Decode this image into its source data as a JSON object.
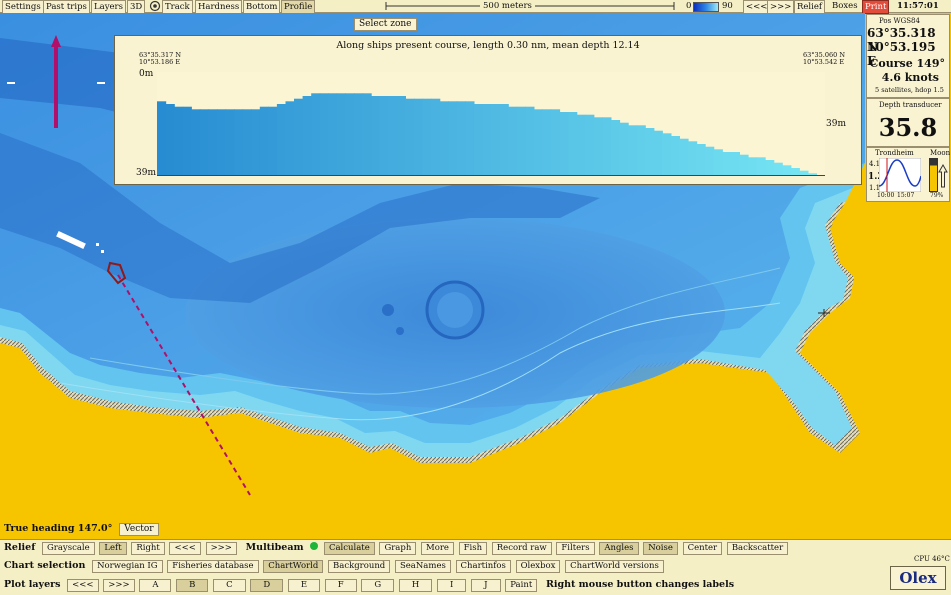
{
  "toolbar": {
    "items": [
      "Settings",
      "Past trips",
      "Layers",
      "3D",
      "Track",
      "Hardness",
      "Bottom",
      "Profile"
    ],
    "scale_label": "500 meters",
    "depth_min": "0",
    "depth_max": "90",
    "nav_left": "<<<",
    "nav_right": ">>>",
    "relief": "Relief",
    "boxes": "Boxes",
    "print": "Print",
    "clock": "11:57:01"
  },
  "select_zone": "Select zone",
  "profile": {
    "title": "Along ships present course, length 0.30 nm, mean depth 12.14",
    "start_coord": "63°35.317 N\n10°53.186 E",
    "end_coord": "63°35.060 N\n10°53.542 E",
    "top_depth": "0m",
    "bottom_depth": "39m",
    "right_depth": "39m",
    "depth_profile": [
      28,
      27,
      26,
      26,
      25,
      25,
      25,
      25,
      25,
      25,
      25,
      25,
      26,
      26,
      27,
      28,
      29,
      30,
      31,
      31,
      31,
      31,
      31,
      31,
      31,
      30,
      30,
      30,
      30,
      29,
      29,
      29,
      29,
      28,
      28,
      28,
      28,
      27,
      27,
      27,
      27,
      26,
      26,
      26,
      25,
      25,
      25,
      24,
      24,
      23,
      23,
      22,
      22,
      21,
      20,
      19,
      19,
      18,
      17,
      16,
      15,
      14,
      13,
      12,
      11,
      10,
      9,
      9,
      8,
      7,
      7,
      6,
      5,
      4,
      3,
      2,
      1,
      0
    ]
  },
  "position": {
    "header": "Pos WGS84",
    "lat": "63°35.318 N",
    "lon": "10°53.195 E",
    "course": "Course 149°",
    "speed": "4.6 knots",
    "sats": "5 satellites, hdop 1.5"
  },
  "depth": {
    "label": "Depth transducer",
    "value": "35.8"
  },
  "tide": {
    "label": "Trondheim",
    "moon_label": "Moon",
    "high": "4.1",
    "current": "1.2",
    "low": "1.1",
    "time_left": "10:00",
    "time_right": "15:07",
    "moon_percent": "79%"
  },
  "status": {
    "heading": "True heading 147.0°",
    "vector": "Vector",
    "cpu": "CPU 46°C",
    "logo": "Olex"
  },
  "rows": {
    "relief": {
      "label": "Relief",
      "items": [
        "Grayscale",
        "Left",
        "Right",
        "<<<",
        ">>>"
      ]
    },
    "multibeam": {
      "label": "Multibeam",
      "items": [
        "Calculate",
        "Graph",
        "More",
        "Fish",
        "Record raw",
        "Filters",
        "Angles",
        "Noise",
        "Center",
        "Backscatter"
      ]
    },
    "chart": {
      "label": "Chart selection",
      "items": [
        "Norwegian IG",
        "Fisheries database",
        "ChartWorld",
        "Background",
        "SeaNames",
        "Chartinfos",
        "Olexbox",
        "ChartWorld versions"
      ]
    },
    "plot": {
      "label": "Plot layers",
      "items": [
        "<<<",
        ">>>",
        "A",
        "B",
        "C",
        "D",
        "E",
        "F",
        "G",
        "H",
        "I",
        "J",
        "Paint",
        "Right mouse button changes labels"
      ]
    }
  },
  "colors": {
    "land": "#f7c400",
    "panel": "#f9f3d2",
    "deep": "#2f7fd0",
    "shallow": "#8ae6f3",
    "track": "#b0106a"
  }
}
